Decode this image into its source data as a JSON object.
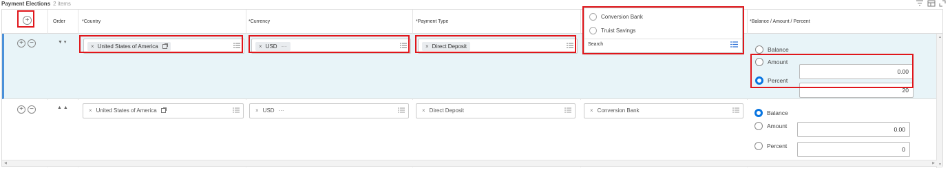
{
  "header": {
    "title": "Payment Elections",
    "count": "2 items"
  },
  "columns": {
    "order": "Order",
    "country": "*Country",
    "currency": "*Currency",
    "payment_type": "*Payment Type",
    "balance": "*Balance / Amount / Percent"
  },
  "account_dropdown": {
    "options": [
      "Conversion Bank",
      "Truist Savings"
    ],
    "search_placeholder": "Search"
  },
  "rows": [
    {
      "country": "United States of America",
      "currency": "USD",
      "currency_more": "···",
      "payment_type": "Direct Deposit",
      "balance_label": "Balance",
      "amount_label": "Amount",
      "percent_label": "Percent",
      "amount_value": "0.00",
      "percent_value": "20",
      "selected": "Percent"
    },
    {
      "country": "United States of America",
      "currency": "USD",
      "currency_more": "···",
      "payment_type": "Direct Deposit",
      "account": "Conversion Bank",
      "balance_label": "Balance",
      "amount_label": "Amount",
      "percent_label": "Percent",
      "amount_value": "0.00",
      "percent_value": "0",
      "selected": "Balance"
    }
  ],
  "icons": {
    "add": "add-row-icon",
    "remove": "remove-row-icon",
    "filter": "filter-icon",
    "columns": "columns-icon",
    "expand": "expand-icon"
  },
  "colors": {
    "selected_row_bg": "#e8f4f8",
    "selected_row_accent": "#4a90d9",
    "radio_selected": "#0875e1",
    "highlight_box": "#e0161b"
  }
}
